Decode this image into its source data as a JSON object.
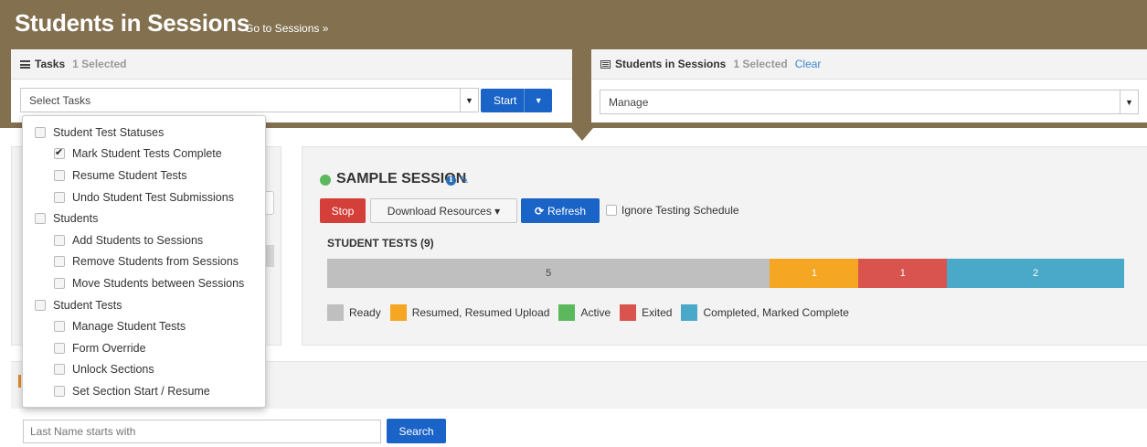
{
  "header": {
    "title": "Students in Sessions",
    "goto_link": "Go to Sessions »"
  },
  "tasks_panel": {
    "title": "Tasks",
    "selected": "1 Selected",
    "select_placeholder": "Select Tasks",
    "start_label": "Start"
  },
  "sis_panel": {
    "title": "Students in Sessions",
    "selected": "1 Selected",
    "clear_label": "Clear",
    "select_value": "Manage"
  },
  "dropdown": {
    "items": [
      {
        "label": "Student Test Statuses",
        "level": 0,
        "checked": false
      },
      {
        "label": "Mark Student Tests Complete",
        "level": 1,
        "checked": true
      },
      {
        "label": "Resume Student Tests",
        "level": 1,
        "checked": false
      },
      {
        "label": "Undo Student Test Submissions",
        "level": 1,
        "checked": false
      },
      {
        "label": "Students",
        "level": 0,
        "checked": false
      },
      {
        "label": "Add Students to Sessions",
        "level": 1,
        "checked": false
      },
      {
        "label": "Remove Students from Sessions",
        "level": 1,
        "checked": false
      },
      {
        "label": "Move Students between Sessions",
        "level": 1,
        "checked": false
      },
      {
        "label": "Student Tests",
        "level": 0,
        "checked": false
      },
      {
        "label": "Manage Student Tests",
        "level": 1,
        "checked": false
      },
      {
        "label": "Form Override",
        "level": 1,
        "checked": false
      },
      {
        "label": "Unlock Sections",
        "level": 1,
        "checked": false
      },
      {
        "label": "Set Section Start / Resume",
        "level": 1,
        "checked": false
      }
    ]
  },
  "session": {
    "name": "SAMPLE SESSION",
    "status_color": "#5cb85c",
    "stop_label": "Stop",
    "download_label": "Download Resources ▾",
    "refresh_label": "Refresh",
    "ignore_label": "Ignore Testing Schedule",
    "tests_title": "STUDENT TESTS (9)",
    "progress": [
      {
        "count": "5",
        "value": 5,
        "color": "#bfbfbf",
        "class": "gray"
      },
      {
        "count": "1",
        "value": 1,
        "color": "#f5a623",
        "class": ""
      },
      {
        "count": "1",
        "value": 1,
        "color": "#d9534f",
        "class": ""
      },
      {
        "count": "2",
        "value": 2,
        "color": "#4aa8c8",
        "class": ""
      }
    ],
    "legend": [
      {
        "label": "Ready",
        "color": "#bfbfbf"
      },
      {
        "label": "Resumed, Resumed Upload",
        "color": "#f5a623"
      },
      {
        "label": "Active",
        "color": "#5cb85c"
      },
      {
        "label": "Exited",
        "color": "#d9534f"
      },
      {
        "label": "Completed, Marked Complete",
        "color": "#4aa8c8"
      }
    ]
  },
  "search": {
    "placeholder": "Last Name starts with",
    "button_label": "Search"
  }
}
